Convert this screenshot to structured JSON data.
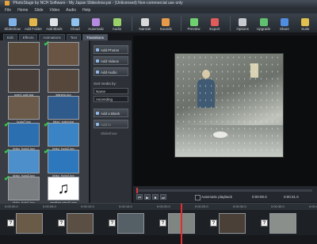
{
  "window": {
    "title": "PhotoStage by NCH Software - My Japan Slideshow.psi - (Unlicensed) Non-commercial use only"
  },
  "menu": [
    "File",
    "Home",
    "Slide",
    "Video",
    "Audio",
    "Help"
  ],
  "toolbar": {
    "buttons": [
      {
        "label": "Slideshow",
        "icon": "slideshow-icon",
        "color": "#7fb3e8"
      },
      {
        "label": "Add Folder",
        "icon": "folder-icon",
        "color": "#e2b64a"
      },
      {
        "label": "Add Blank",
        "icon": "blank-slide-icon",
        "color": "#dfe3e8"
      },
      {
        "label": "Cloud",
        "icon": "cloud-icon",
        "color": "#8fc2ee"
      },
      {
        "label": "Automatic",
        "icon": "wand-icon",
        "color": "#b58ae0"
      },
      {
        "label": "Audio",
        "icon": "audio-icon",
        "color": "#9ad16a"
      },
      {
        "label": "Narrate",
        "icon": "microphone-icon",
        "color": "#d9d9d9"
      },
      {
        "label": "Sounds",
        "icon": "sounds-icon",
        "color": "#e79b4a"
      },
      {
        "label": "Preview",
        "icon": "preview-icon",
        "color": "#6fd06f"
      },
      {
        "label": "Export",
        "icon": "export-icon",
        "color": "#e05b5b"
      },
      {
        "label": "Options",
        "icon": "options-icon",
        "color": "#c7cbd0"
      },
      {
        "label": "Upgrade",
        "icon": "upgrade-icon",
        "color": "#5fc06f"
      },
      {
        "label": "Share",
        "icon": "share-icon",
        "color": "#4f8de0"
      },
      {
        "label": "Suite",
        "icon": "suite-icon",
        "color": "#e0c04f"
      }
    ]
  },
  "tabs": [
    "Edit",
    "Effects",
    "Animations",
    "Text",
    "Transitions"
  ],
  "media": {
    "items": [
      {
        "caption": "",
        "checked": false,
        "color": "#5a4a3a"
      },
      {
        "caption": "",
        "checked": true,
        "color": "#6a5544"
      },
      {
        "caption": "over1 ude.jpg",
        "checked": false,
        "color": "#4a3f38"
      },
      {
        "caption": "klsheto.jpg",
        "checked": false,
        "color": "#55473c"
      },
      {
        "caption": "kudo7.jpg",
        "checked": false,
        "color": "#6b5a49"
      },
      {
        "caption": "kbzo_sutra.jpg",
        "checked": false,
        "color": "#2f5a8c"
      },
      {
        "caption": "kbko_fudo1.jpg",
        "checked": true,
        "color": "#2c6fb0"
      },
      {
        "caption": "kbko_fudo2.jpg",
        "checked": true,
        "color": "#3a83c4"
      },
      {
        "caption": "kbko_fudo3.jpg",
        "checked": true,
        "color": "#4d8fcb"
      },
      {
        "caption": "kbko_fudo4.jpg",
        "checked": true,
        "color": "#2d78bd"
      },
      {
        "caption": "kbko_fudo1.jpg",
        "checked": true,
        "color": "#7a7d80"
      },
      {
        "caption": "weather wind4.wav",
        "checked": false,
        "color": "#ffffff"
      }
    ]
  },
  "side": {
    "add_photos": "Add Photos",
    "add_videos": "Add Videos",
    "add_audio": "Add Audio",
    "sort_label": "Sort media by:",
    "sort_value": "Name",
    "order_value": "Ascending",
    "add_blank": "Add a Blank Slide",
    "add_to_slideshow": "Add to Slideshow"
  },
  "controls": {
    "automatic_playback": "Automatic playback",
    "time_start": "0:00:00.0",
    "time_end": "0:00:31.0"
  },
  "timeline": {
    "ruler": [
      "0:00:00.0",
      "0:00:05.0",
      "0:00:10.0",
      "0:00:15.0",
      "0:00:20.0",
      "0:00:25.0",
      "0:00:30.0",
      "0:00:35.0",
      "0:00:40.0"
    ],
    "clips": [
      {
        "color": "#6a5a48"
      },
      {
        "color": "#5b4f44"
      },
      {
        "color": "#556066"
      },
      {
        "color": "#7f8580"
      },
      {
        "color": "#4a4038"
      },
      {
        "color": "#8a8f8b"
      }
    ]
  }
}
